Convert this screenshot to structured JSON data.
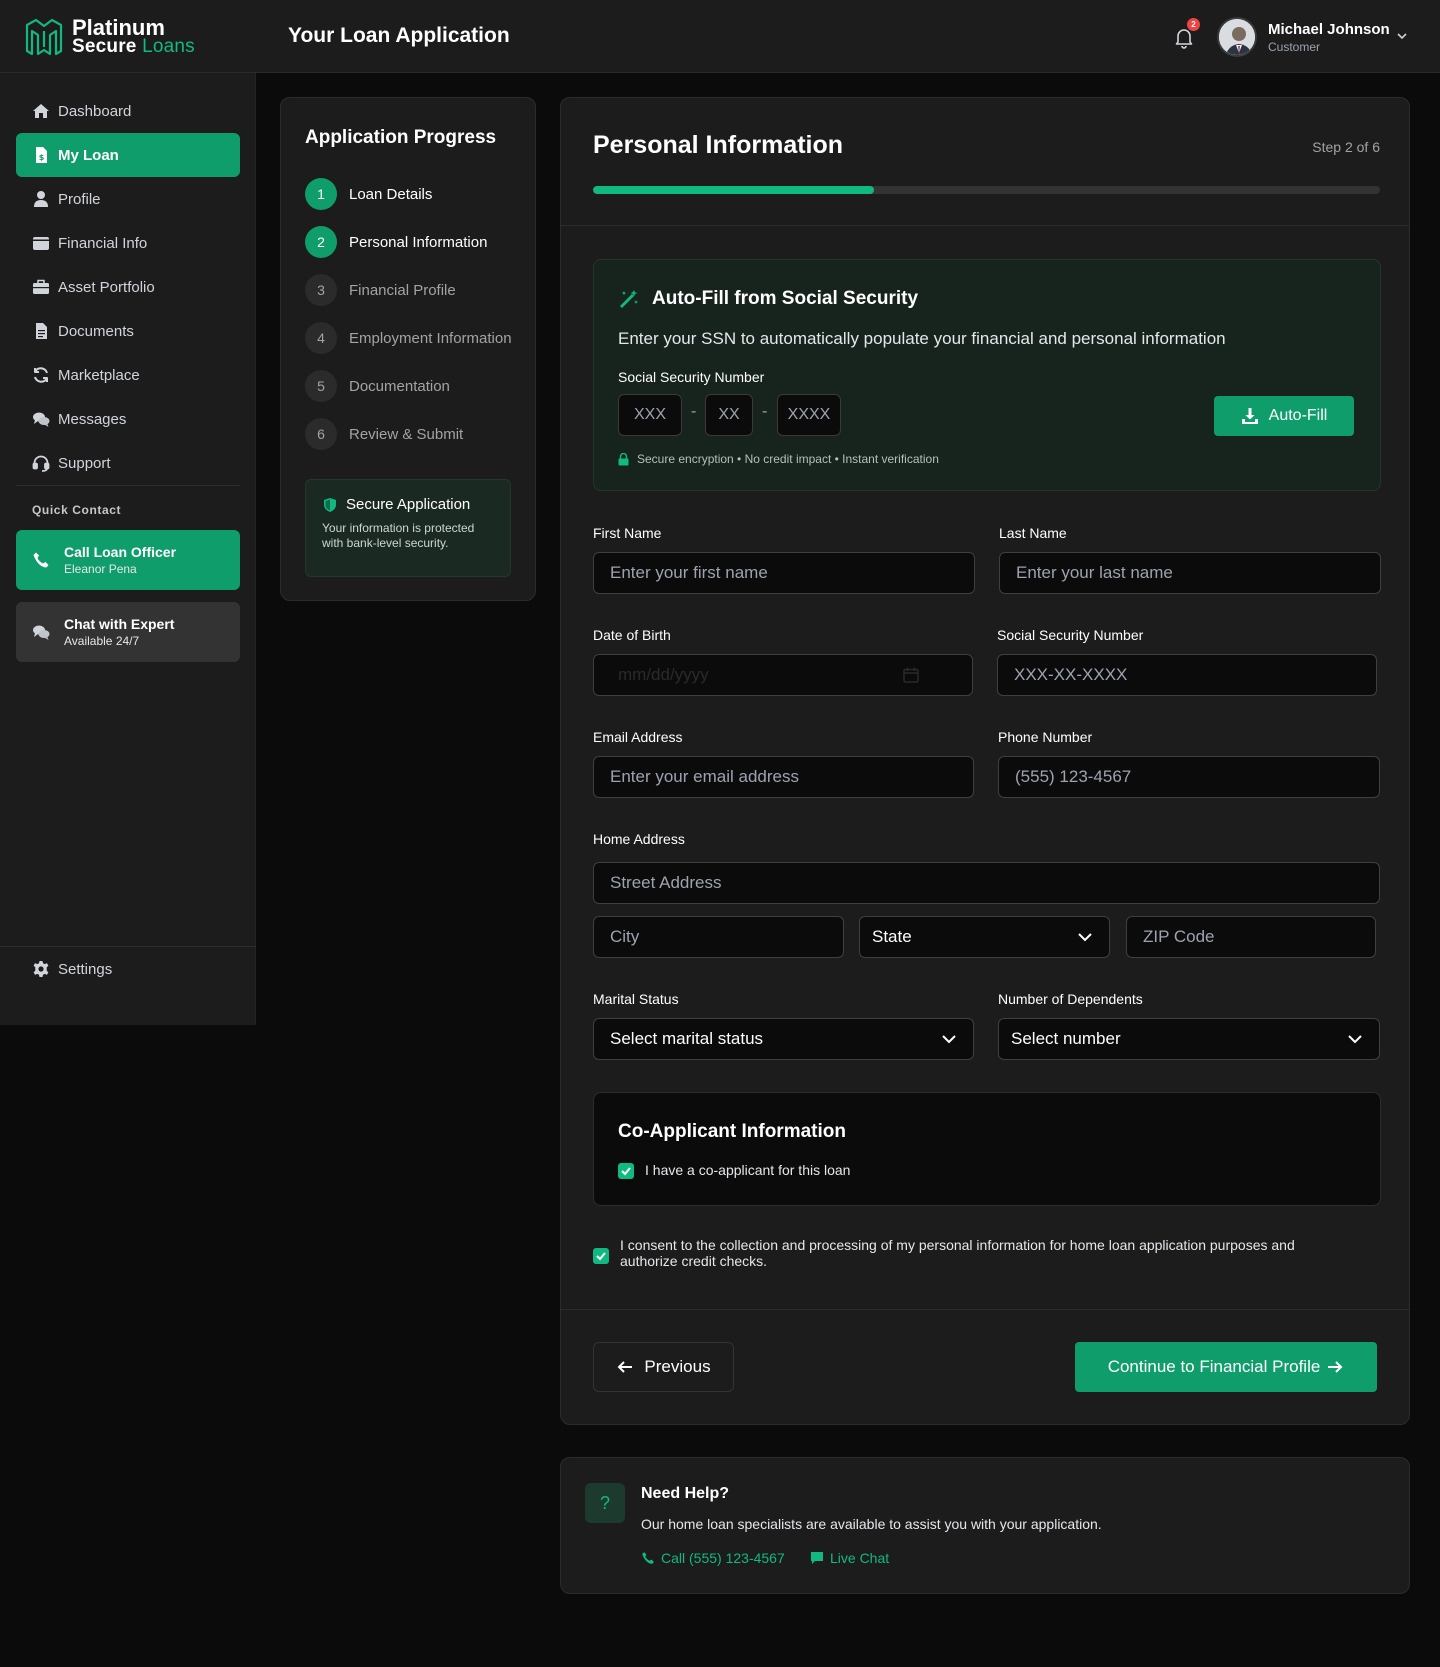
{
  "brand": {
    "name_line1": "Platinum",
    "name_line2a": "Secure",
    "name_line2b": "Loans"
  },
  "header": {
    "title": "Your Loan Application",
    "notifications_count": "2",
    "user_name": "Michael Johnson",
    "user_role": "Customer"
  },
  "sidebar": {
    "items": [
      {
        "label": "Dashboard",
        "icon": "home-icon"
      },
      {
        "label": "My Loan",
        "icon": "document-dollar-icon",
        "active": true
      },
      {
        "label": "Profile",
        "icon": "user-icon"
      },
      {
        "label": "Financial Info",
        "icon": "wallet-icon"
      },
      {
        "label": "Asset Portfolio",
        "icon": "briefcase-icon"
      },
      {
        "label": "Documents",
        "icon": "file-icon"
      },
      {
        "label": "Marketplace",
        "icon": "sync-icon"
      },
      {
        "label": "Messages",
        "icon": "comments-icon"
      },
      {
        "label": "Support",
        "icon": "headset-icon"
      }
    ],
    "quick_contact_title": "Quick Contact",
    "call_officer": {
      "title": "Call Loan Officer",
      "subtitle": "Eleanor Pena"
    },
    "chat_expert": {
      "title": "Chat with Expert",
      "subtitle": "Available 24/7"
    },
    "settings_label": "Settings"
  },
  "progress": {
    "title": "Application Progress",
    "steps": [
      {
        "num": "1",
        "label": "Loan Details",
        "state": "done"
      },
      {
        "num": "2",
        "label": "Personal Information",
        "state": "current"
      },
      {
        "num": "3",
        "label": "Financial Profile",
        "state": "todo"
      },
      {
        "num": "4",
        "label": "Employment Information",
        "state": "todo"
      },
      {
        "num": "5",
        "label": "Documentation",
        "state": "todo"
      },
      {
        "num": "6",
        "label": "Review & Submit",
        "state": "todo"
      }
    ],
    "secure_title": "Secure Application",
    "secure_text": "Your information is protected with bank-level security."
  },
  "form": {
    "title": "Personal Information",
    "step_text": "Step 2 of 6",
    "progress_fraction": 0.357,
    "autofill": {
      "title": "Auto-Fill from Social Security",
      "description": "Enter your SSN to automatically populate your financial and personal information",
      "ssn_label": "Social Security Number",
      "ssn_part1_placeholder": "XXX",
      "ssn_part2_placeholder": "XX",
      "ssn_part3_placeholder": "XXXX",
      "dash": "-",
      "button_label": "Auto-Fill",
      "note": "Secure encryption • No credit impact • Instant verification"
    },
    "first_name": {
      "label": "First Name",
      "placeholder": "Enter your first name"
    },
    "last_name": {
      "label": "Last Name",
      "placeholder": "Enter your last name"
    },
    "dob": {
      "label": "Date of Birth",
      "placeholder": "mm/dd/yyyy"
    },
    "ssn": {
      "label": "Social Security Number",
      "placeholder": "XXX-XX-XXXX"
    },
    "email": {
      "label": "Email Address",
      "placeholder": "Enter your email address"
    },
    "phone": {
      "label": "Phone Number",
      "placeholder": "(555) 123-4567"
    },
    "address": {
      "label": "Home Address",
      "street_placeholder": "Street Address",
      "city_placeholder": "City",
      "state_value": "State",
      "zip_placeholder": "ZIP Code"
    },
    "marital": {
      "label": "Marital Status",
      "value": "Select marital status"
    },
    "dependents": {
      "label": "Number of Dependents",
      "value": "Select number"
    },
    "coapplicant": {
      "title": "Co-Applicant Information",
      "checkbox_label": "I have a co-applicant for this loan",
      "checked": true
    },
    "consent_text": "I consent to the collection and processing of my personal information for home loan application purposes and authorize credit checks.",
    "consent_checked": true,
    "prev_label": "Previous",
    "next_label": "Continue to Financial Profile"
  },
  "help": {
    "icon": "?",
    "title": "Need Help?",
    "text": "Our home loan specialists are available to assist you with your application.",
    "call_label": "Call (555) 123-4567",
    "chat_label": "Live Chat"
  },
  "colors": {
    "accent": "#10b981",
    "accent_dark": "#0f9d6c",
    "background": "#0b0b0b",
    "panel": "#1c1c1c"
  }
}
